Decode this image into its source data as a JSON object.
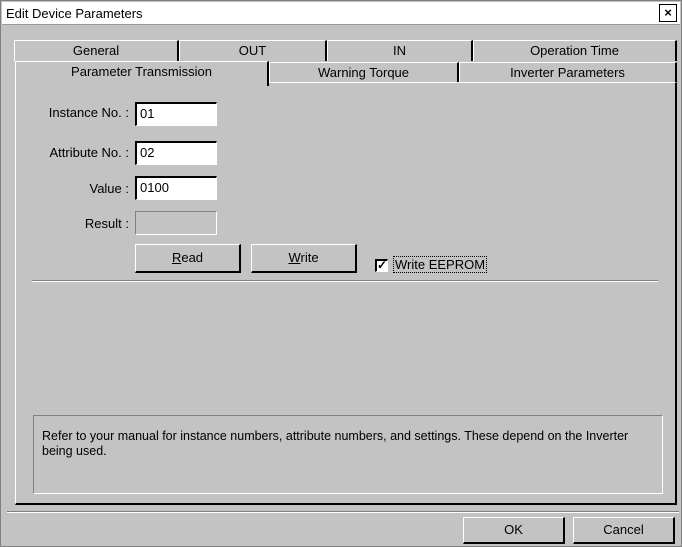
{
  "window": {
    "title": "Edit Device Parameters",
    "close_glyph": "×"
  },
  "tabs": {
    "row1": [
      "General",
      "OUT",
      "IN",
      "Operation Time"
    ],
    "row2": [
      "Parameter Transmission",
      "Warning Torque",
      "Inverter Parameters"
    ],
    "active": "Parameter Transmission"
  },
  "form": {
    "instance_label": "Instance No. :",
    "instance_value": "01",
    "attribute_label": "Attribute No. :",
    "attribute_value": "02",
    "value_label": "Value :",
    "value_value": "0100",
    "result_label": "Result :",
    "result_value": ""
  },
  "actions": {
    "read_prefix": "R",
    "read_rest": "ead",
    "write_prefix": "W",
    "write_rest": "rite",
    "write_eeprom_checked": true,
    "check_glyph": "✓",
    "write_eeprom_label": "Write EEPROM"
  },
  "note": "Refer to your manual for instance numbers, attribute numbers, and settings. These depend on the Inverter being used.",
  "footer": {
    "ok_label": "OK",
    "cancel_label": "Cancel"
  }
}
